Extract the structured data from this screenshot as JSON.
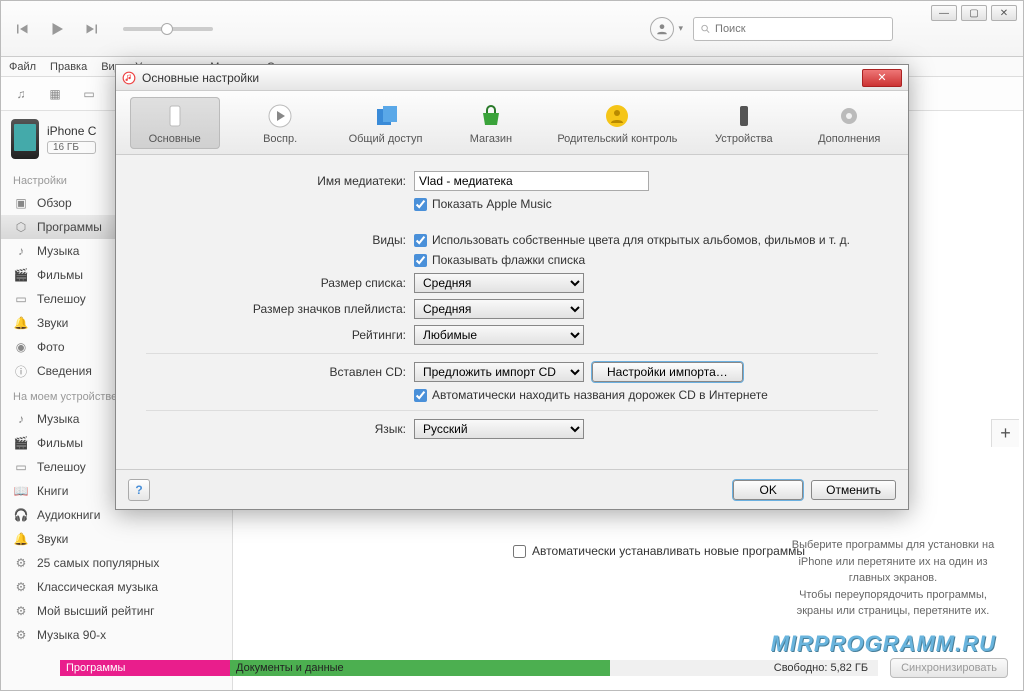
{
  "search": {
    "placeholder": "Поиск"
  },
  "menu": [
    "Файл",
    "Правка",
    "Вид",
    "Управление",
    "Магазин",
    "Справка"
  ],
  "device": {
    "name": "iPhone C",
    "capacity": "16 ГБ"
  },
  "sections": {
    "settings": {
      "title": "Настройки",
      "items": [
        {
          "icon": "overview",
          "label": "Обзор"
        },
        {
          "icon": "apps",
          "label": "Программы"
        },
        {
          "icon": "music",
          "label": "Музыка"
        },
        {
          "icon": "movies",
          "label": "Фильмы"
        },
        {
          "icon": "tv",
          "label": "Телешоу"
        },
        {
          "icon": "sounds",
          "label": "Звуки"
        },
        {
          "icon": "photos",
          "label": "Фото"
        },
        {
          "icon": "info",
          "label": "Сведения"
        }
      ]
    },
    "ondevice": {
      "title": "На моем устройстве",
      "items": [
        {
          "icon": "music",
          "label": "Музыка"
        },
        {
          "icon": "movies",
          "label": "Фильмы"
        },
        {
          "icon": "tv",
          "label": "Телешоу"
        },
        {
          "icon": "books",
          "label": "Книги"
        },
        {
          "icon": "audiobooks",
          "label": "Аудиокниги"
        },
        {
          "icon": "sounds",
          "label": "Звуки"
        },
        {
          "icon": "popular",
          "label": "25 самых популярных"
        },
        {
          "icon": "classical",
          "label": "Классическая музыка"
        },
        {
          "icon": "toprated",
          "label": "Мой высший рейтинг"
        },
        {
          "icon": "90s",
          "label": "Музыка 90-х"
        }
      ]
    }
  },
  "auto_install": "Автоматически устанавливать новые программы",
  "hint_line1": "Выберите программы для установки на iPhone или перетяните их на один из главных экранов.",
  "hint_line2": "Чтобы переупорядочить программы, экраны или страницы, перетяните их.",
  "storage": {
    "apps": "Программы",
    "docs": "Документы и данные",
    "free": "Свободно: 5,82 ГБ",
    "sync": "Синхронизировать"
  },
  "watermark": "MIRPROGRAMM.RU",
  "dialog": {
    "title": "Основные настройки",
    "tabs": [
      "Основные",
      "Воспр.",
      "Общий доступ",
      "Магазин",
      "Родительский контроль",
      "Устройства",
      "Дополнения"
    ],
    "labels": {
      "library": "Имя медиатеки:",
      "views": "Виды:",
      "listsize": "Размер списка:",
      "plistsize": "Размер значков плейлиста:",
      "ratings": "Рейтинги:",
      "cd": "Вставлен CD:",
      "lang": "Язык:"
    },
    "values": {
      "library": "Vlad - медиатека",
      "show_am": "Показать Apple Music",
      "own_colors": "Использовать собственные цвета для открытых альбомов, фильмов и т. д.",
      "show_flags": "Показывать флажки списка",
      "listsize": "Средняя",
      "plistsize": "Средняя",
      "ratings": "Любимые",
      "cd": "Предложить импорт CD",
      "import_btn": "Настройки импорта…",
      "auto_cd": "Автоматически находить названия дорожек CD в Интернете",
      "lang": "Русский"
    },
    "buttons": {
      "help": "?",
      "ok": "OK",
      "cancel": "Отменить"
    }
  }
}
